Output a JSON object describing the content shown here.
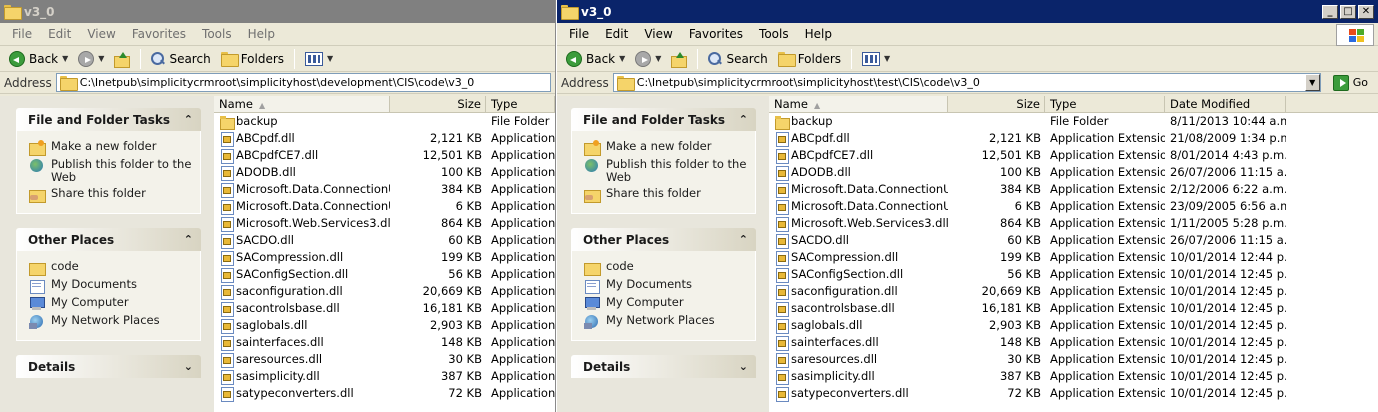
{
  "left_window": {
    "title": "v3_0",
    "menu": [
      "File",
      "Edit",
      "View",
      "Favorites",
      "Tools",
      "Help"
    ],
    "toolbar": {
      "back": "Back",
      "search": "Search",
      "folders": "Folders"
    },
    "address_label": "Address",
    "address": "C:\\Inetpub\\simplicitycrmroot\\simplicityhost\\development\\CIS\\code\\v3_0",
    "columns": {
      "name": "Name",
      "size": "Size",
      "type": "Type"
    },
    "files": [
      {
        "name": "backup",
        "size": "",
        "type": "File Folder",
        "icon": "folder-icon"
      },
      {
        "name": "ABCpdf.dll",
        "size": "2,121 KB",
        "type": "Application E",
        "icon": "dll-icon"
      },
      {
        "name": "ABCpdfCE7.dll",
        "size": "12,501 KB",
        "type": "Application E",
        "icon": "dll-icon"
      },
      {
        "name": "ADODB.dll",
        "size": "100 KB",
        "type": "Application E",
        "icon": "dll-icon"
      },
      {
        "name": "Microsoft.Data.ConnectionUI....",
        "size": "384 KB",
        "type": "Application E",
        "icon": "dll-icon"
      },
      {
        "name": "Microsoft.Data.ConnectionUI.dll",
        "size": "6 KB",
        "type": "Application E",
        "icon": "dll-icon"
      },
      {
        "name": "Microsoft.Web.Services3.dll",
        "size": "864 KB",
        "type": "Application E",
        "icon": "dll-icon"
      },
      {
        "name": "SACDO.dll",
        "size": "60 KB",
        "type": "Application E",
        "icon": "dll-icon"
      },
      {
        "name": "SACompression.dll",
        "size": "199 KB",
        "type": "Application E",
        "icon": "dll-icon"
      },
      {
        "name": "SAConfigSection.dll",
        "size": "56 KB",
        "type": "Application E",
        "icon": "dll-icon"
      },
      {
        "name": "saconfiguration.dll",
        "size": "20,669 KB",
        "type": "Application E",
        "icon": "dll-icon"
      },
      {
        "name": "sacontrolsbase.dll",
        "size": "16,181 KB",
        "type": "Application E",
        "icon": "dll-icon"
      },
      {
        "name": "saglobals.dll",
        "size": "2,903 KB",
        "type": "Application E",
        "icon": "dll-icon"
      },
      {
        "name": "sainterfaces.dll",
        "size": "148 KB",
        "type": "Application E",
        "icon": "dll-icon"
      },
      {
        "name": "saresources.dll",
        "size": "30 KB",
        "type": "Application E",
        "icon": "dll-icon"
      },
      {
        "name": "sasimplicity.dll",
        "size": "387 KB",
        "type": "Application E",
        "icon": "dll-icon"
      },
      {
        "name": "satypeconverters.dll",
        "size": "72 KB",
        "type": "Application E",
        "icon": "dll-icon"
      }
    ]
  },
  "right_window": {
    "title": "v3_0",
    "menu": [
      "File",
      "Edit",
      "View",
      "Favorites",
      "Tools",
      "Help"
    ],
    "toolbar": {
      "back": "Back",
      "search": "Search",
      "folders": "Folders"
    },
    "address_label": "Address",
    "address": "C:\\Inetpub\\simplicitycrmroot\\simplicityhost\\test\\CIS\\code\\v3_0",
    "go_label": "Go",
    "columns": {
      "name": "Name",
      "size": "Size",
      "type": "Type",
      "date": "Date Modified"
    },
    "files": [
      {
        "name": "backup",
        "size": "",
        "type": "File Folder",
        "date": "8/11/2013 10:44 a.m.",
        "icon": "folder-icon"
      },
      {
        "name": "ABCpdf.dll",
        "size": "2,121 KB",
        "type": "Application Extension",
        "date": "21/08/2009 1:34 p.m.",
        "icon": "dll-icon"
      },
      {
        "name": "ABCpdfCE7.dll",
        "size": "12,501 KB",
        "type": "Application Extension",
        "date": "8/01/2014 4:43 p.m.",
        "icon": "dll-icon"
      },
      {
        "name": "ADODB.dll",
        "size": "100 KB",
        "type": "Application Extension",
        "date": "26/07/2006 11:15 a....",
        "icon": "dll-icon"
      },
      {
        "name": "Microsoft.Data.ConnectionUI....",
        "size": "384 KB",
        "type": "Application Extension",
        "date": "2/12/2006 6:22 a.m.",
        "icon": "dll-icon"
      },
      {
        "name": "Microsoft.Data.ConnectionUI.dll",
        "size": "6 KB",
        "type": "Application Extension",
        "date": "23/09/2005 6:56 a.m.",
        "icon": "dll-icon"
      },
      {
        "name": "Microsoft.Web.Services3.dll",
        "size": "864 KB",
        "type": "Application Extension",
        "date": "1/11/2005 5:28 p.m.",
        "icon": "dll-icon"
      },
      {
        "name": "SACDO.dll",
        "size": "60 KB",
        "type": "Application Extension",
        "date": "26/07/2006 11:15 a....",
        "icon": "dll-icon"
      },
      {
        "name": "SACompression.dll",
        "size": "199 KB",
        "type": "Application Extension",
        "date": "10/01/2014 12:44 p....",
        "icon": "dll-icon"
      },
      {
        "name": "SAConfigSection.dll",
        "size": "56 KB",
        "type": "Application Extension",
        "date": "10/01/2014 12:45 p....",
        "icon": "dll-icon"
      },
      {
        "name": "saconfiguration.dll",
        "size": "20,669 KB",
        "type": "Application Extension",
        "date": "10/01/2014 12:45 p....",
        "icon": "dll-icon"
      },
      {
        "name": "sacontrolsbase.dll",
        "size": "16,181 KB",
        "type": "Application Extension",
        "date": "10/01/2014 12:45 p....",
        "icon": "dll-icon"
      },
      {
        "name": "saglobals.dll",
        "size": "2,903 KB",
        "type": "Application Extension",
        "date": "10/01/2014 12:45 p....",
        "icon": "dll-icon"
      },
      {
        "name": "sainterfaces.dll",
        "size": "148 KB",
        "type": "Application Extension",
        "date": "10/01/2014 12:45 p....",
        "icon": "dll-icon"
      },
      {
        "name": "saresources.dll",
        "size": "30 KB",
        "type": "Application Extension",
        "date": "10/01/2014 12:45 p....",
        "icon": "dll-icon"
      },
      {
        "name": "sasimplicity.dll",
        "size": "387 KB",
        "type": "Application Extension",
        "date": "10/01/2014 12:45 p....",
        "icon": "dll-icon"
      },
      {
        "name": "satypeconverters.dll",
        "size": "72 KB",
        "type": "Application Extension",
        "date": "10/01/2014 12:45 p....",
        "icon": "dll-icon"
      }
    ]
  },
  "tasks": {
    "file_folder_tasks": {
      "title": "File and Folder Tasks",
      "items": [
        {
          "label": "Make a new folder",
          "icon": "new-folder-icon"
        },
        {
          "label": "Publish this folder to the Web",
          "icon": "publish-web-icon"
        },
        {
          "label": "Share this folder",
          "icon": "share-folder-icon"
        }
      ]
    },
    "other_places": {
      "title": "Other Places",
      "items": [
        {
          "label": "code",
          "icon": "folder-icon"
        },
        {
          "label": "My Documents",
          "icon": "my-documents-icon"
        },
        {
          "label": "My Computer",
          "icon": "my-computer-icon"
        },
        {
          "label": "My Network Places",
          "icon": "network-places-icon"
        }
      ]
    },
    "details": {
      "title": "Details"
    }
  },
  "colors": {
    "active_title": "#0a246a",
    "inactive_title": "#808080",
    "pane_bg": "#e8e6dc"
  }
}
